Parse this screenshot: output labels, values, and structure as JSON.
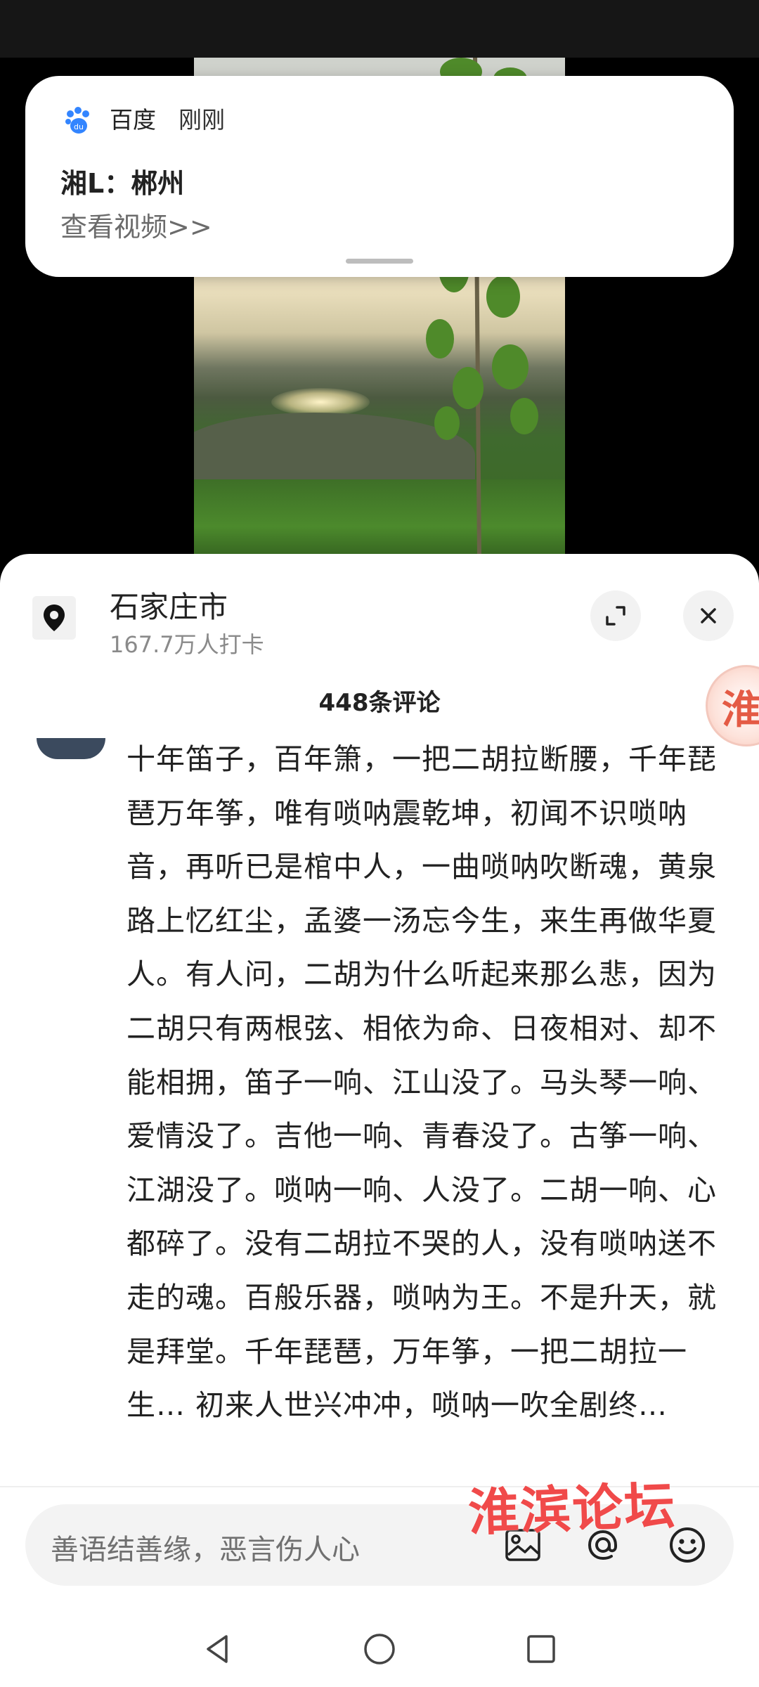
{
  "notification": {
    "app_icon": "baidu-paw-icon",
    "app_name": "百度",
    "time": "刚刚",
    "title": "湘L：郴州",
    "link": "查看视频>>"
  },
  "location": {
    "icon": "location-pin-icon",
    "name": "石家庄市",
    "checkins": "167.7万人打卡"
  },
  "comments": {
    "count_label": "448条评论",
    "items": [
      {
        "text": "十年笛子，百年箫，一把二胡拉断腰，千年琵琶万年筝，唯有唢呐震乾坤，初闻不识唢呐音，再听已是棺中人，一曲唢呐吹断魂，黄泉路上忆红尘，孟婆一汤忘今生，来生再做华夏人。有人问，二胡为什么听起来那么悲，因为二胡只有两根弦、相依为命、日夜相对、却不能相拥，笛子一响、江山没了。马头琴一响、爱情没了。吉他一响、青春没了。古筝一响、江湖没了。唢呐一响、人没了。二胡一响、心都碎了。没有二胡拉不哭的人，没有唢呐送不走的魂。百般乐器，唢呐为王。不是升天，就是拜堂。千年琵琶，万年筝，一把二胡拉一生… 初来人世兴冲冲，唢呐一吹全剧终…"
      }
    ]
  },
  "input": {
    "placeholder": "善语结善缘，恶言伤人心",
    "icons": [
      "image-icon",
      "at-icon",
      "emoji-icon"
    ]
  },
  "floating_badge": "淮",
  "watermark": "淮滨论坛",
  "nav": [
    "back-icon",
    "home-icon",
    "recent-apps-icon"
  ]
}
